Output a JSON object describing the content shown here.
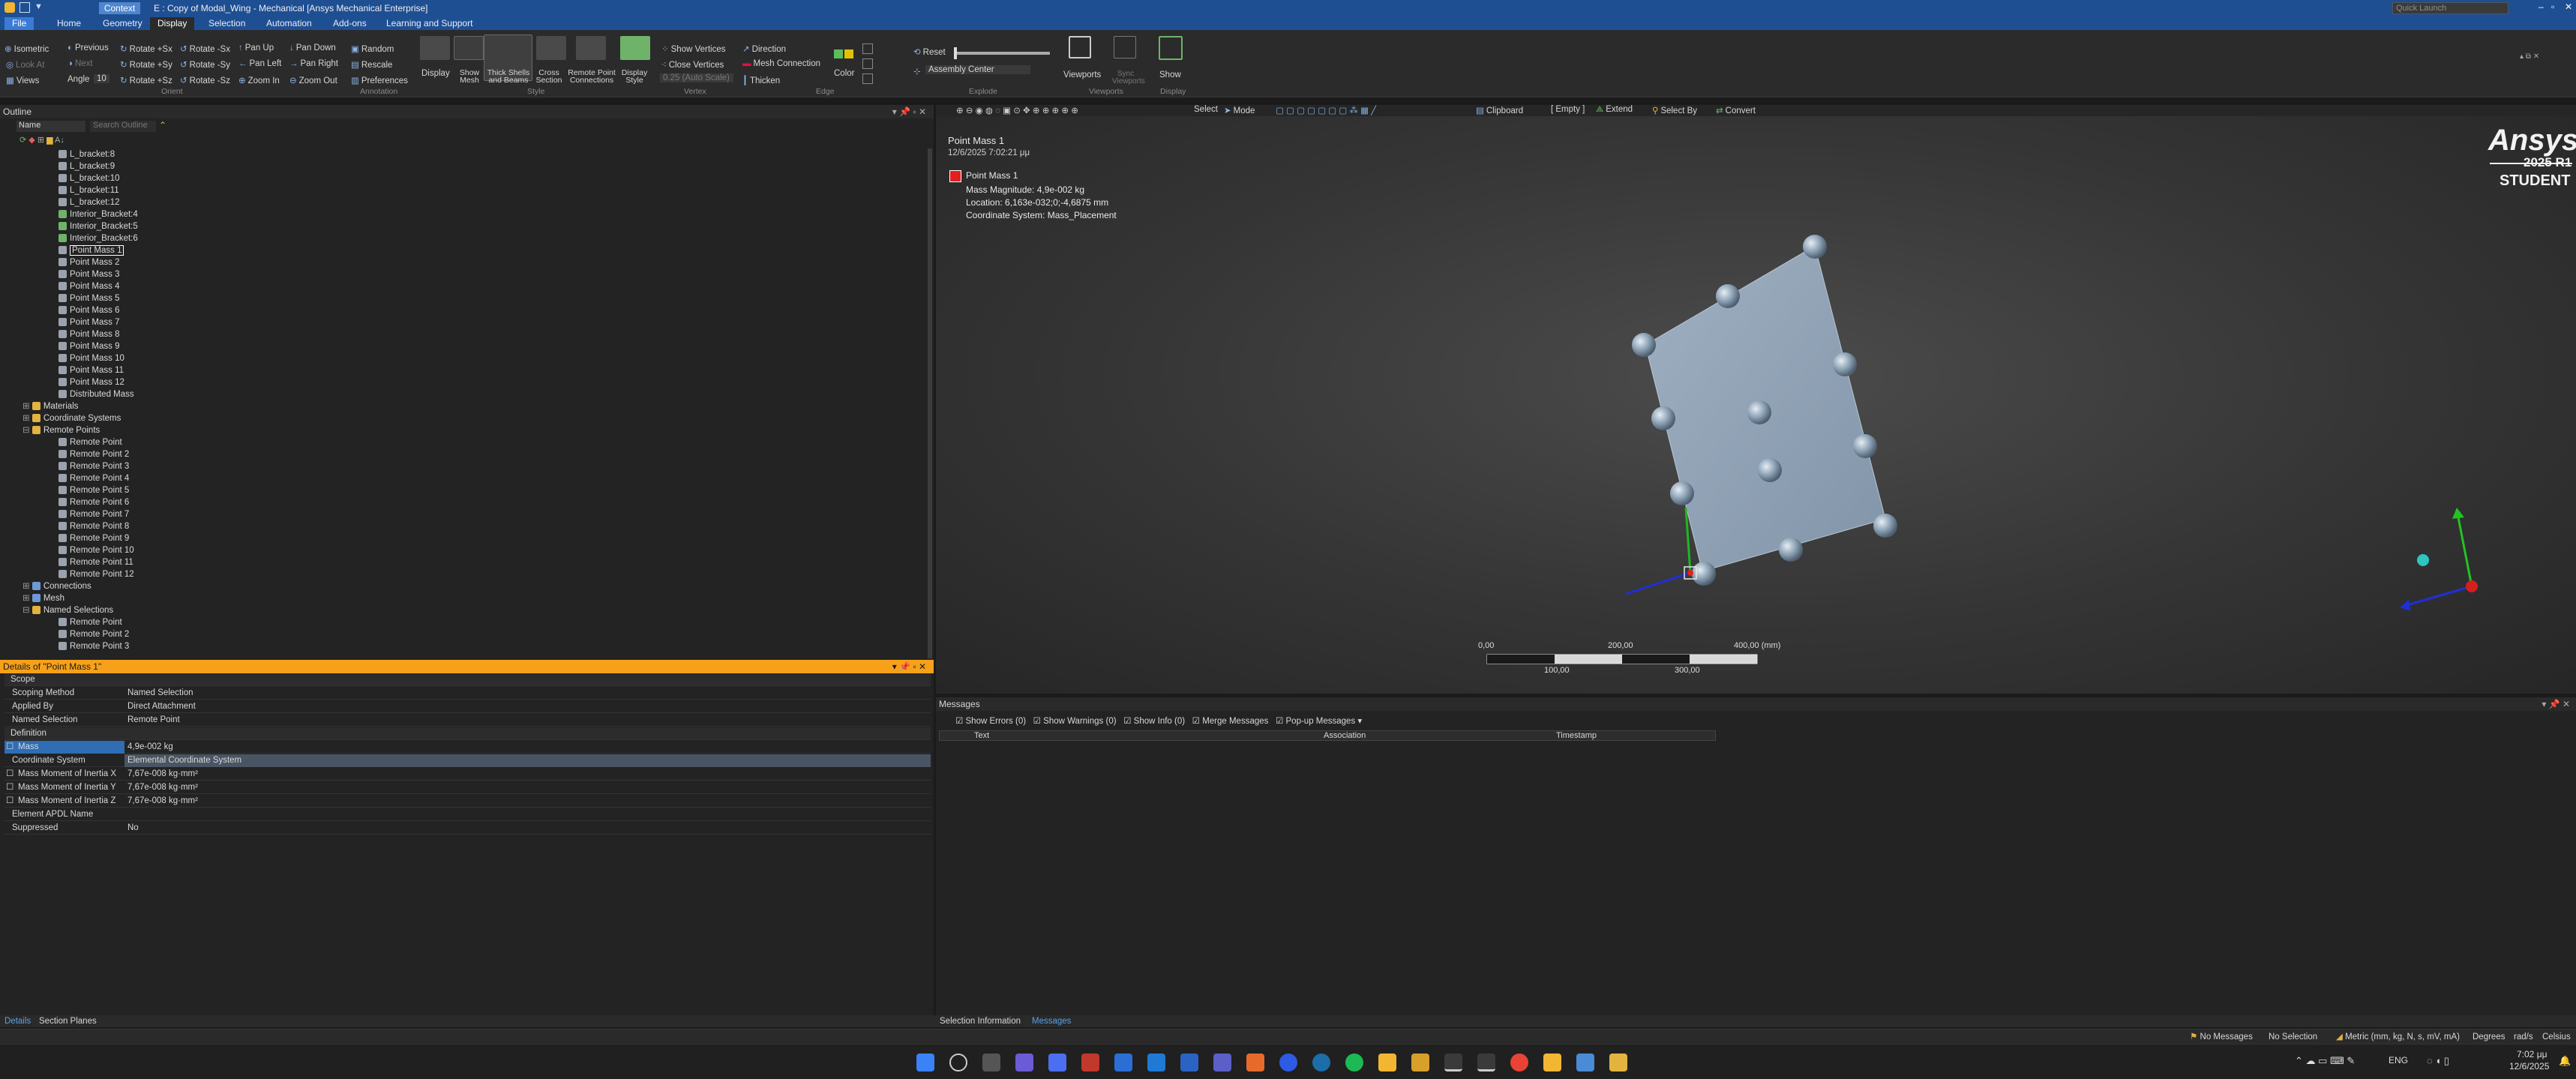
{
  "titlebar": {
    "context": "Context",
    "title": "E : Copy of Modal_Wing - Mechanical [Ansys Mechanical Enterprise]",
    "quick_launch": "Quick Launch"
  },
  "ribbon_tabs": [
    "File",
    "Home",
    "Geometry",
    "Display",
    "Selection",
    "Automation",
    "Add-ons",
    "Learning and Support"
  ],
  "ribbon": {
    "orient": [
      "Isometric",
      "Previous",
      "Next",
      "Look At",
      "Views",
      "Angle",
      "10",
      "Rotate +Sx",
      "Rotate -Sx",
      "Rotate +Sy",
      "Rotate -Sy",
      "Rotate +Sz",
      "Rotate -Sz",
      "Pan Up",
      "Pan Down",
      "Pan Left",
      "Pan Right",
      "Zoom In",
      "Zoom Out"
    ],
    "annotation": [
      "Random",
      "Rescale",
      "Preferences"
    ],
    "style": [
      "Display",
      "Show Mesh",
      "Thick Shells and Beams",
      "Cross Section",
      "Remote Point Connections",
      "Display Style"
    ],
    "vertex": [
      "Show Vertices",
      "Close Vertices",
      "0.25 (Auto Scale)"
    ],
    "edge": [
      "Direction",
      "Mesh Connection",
      "Thicken",
      "Color"
    ],
    "explode": [
      "Reset",
      "Assembly Center"
    ],
    "viewports": [
      "Viewports",
      "Sync Viewports"
    ],
    "display": [
      "Show"
    ],
    "groups": [
      "Orient",
      "Annotation",
      "Style",
      "Vertex",
      "Edge",
      "Explode",
      "Viewports",
      "Display"
    ]
  },
  "outline": {
    "title": "Outline",
    "name_label": "Name",
    "search_placeholder": "Search Outline",
    "items": [
      "L_bracket:8",
      "L_bracket:9",
      "L_bracket:10",
      "L_bracket:11",
      "L_bracket:12",
      "Interior_Bracket:4",
      "Interior_Bracket:5",
      "Interior_Bracket:6",
      "Point Mass 1",
      "Point Mass 2",
      "Point Mass 3",
      "Point Mass 4",
      "Point Mass 5",
      "Point Mass 6",
      "Point Mass 7",
      "Point Mass 8",
      "Point Mass 9",
      "Point Mass 10",
      "Point Mass 11",
      "Point Mass 12",
      "Distributed Mass",
      "Materials",
      "Coordinate Systems",
      "Remote Points",
      "Remote Point",
      "Remote Point 2",
      "Remote Point 3",
      "Remote Point 4",
      "Remote Point 5",
      "Remote Point 6",
      "Remote Point 7",
      "Remote Point 8",
      "Remote Point 9",
      "Remote Point 10",
      "Remote Point 11",
      "Remote Point 12",
      "Connections",
      "Mesh",
      "Named Selections",
      "Remote Point",
      "Remote Point 2",
      "Remote Point 3"
    ]
  },
  "details": {
    "title": "Details of \"Point Mass 1\"",
    "rows": [
      {
        "k": "Scope",
        "v": "",
        "sec": true
      },
      {
        "k": "Scoping Method",
        "v": "Named Selection"
      },
      {
        "k": "Applied By",
        "v": "Direct Attachment"
      },
      {
        "k": "Named Selection",
        "v": "Remote Point"
      },
      {
        "k": "Definition",
        "v": "",
        "sec": true
      },
      {
        "k": "Mass",
        "v": "4,9e-002 kg"
      },
      {
        "k": "Coordinate System",
        "v": "Elemental Coordinate System"
      },
      {
        "k": "Mass Moment of Inertia X",
        "v": "7,67e-008 kg·mm²"
      },
      {
        "k": "Mass Moment of Inertia Y",
        "v": "7,67e-008 kg·mm²"
      },
      {
        "k": "Mass Moment of Inertia Z",
        "v": "7,67e-008 kg·mm²"
      },
      {
        "k": "Element APDL Name",
        "v": ""
      },
      {
        "k": "Suppressed",
        "v": "No"
      }
    ]
  },
  "viewport": {
    "toolbar": [
      "Select",
      "Mode",
      "Clipboard",
      "[ Empty ]",
      "Extend",
      "Select By",
      "Convert"
    ],
    "title": "Point Mass 1",
    "date": "12/6/2025 7:02:21 μμ",
    "legend_label": "Point Mass 1",
    "info": [
      "Mass Magnitude: 4,9e-002 kg",
      "Location: 6,163e-032;0;-4,6875 mm",
      "Coordinate System: Mass_Placement"
    ],
    "brand": "Ansys",
    "version": "2025 R1",
    "edition": "STUDENT",
    "scale": {
      "t0": "0,00",
      "t200": "200,00",
      "t400": "400,00 (mm)",
      "t100": "100,00",
      "t300": "300,00"
    }
  },
  "messages": {
    "title": "Messages",
    "filters": [
      {
        "label": "Show Errors",
        "count": "(0)"
      },
      {
        "label": "Show Warnings",
        "count": "(0)"
      },
      {
        "label": "Show Info",
        "count": "(0)"
      },
      {
        "label": "Merge Messages",
        "count": ""
      },
      {
        "label": "Pop-up Messages",
        "count": ""
      }
    ],
    "columns": [
      "Text",
      "Association",
      "Timestamp"
    ]
  },
  "bottom_tabs": {
    "left": [
      "Details",
      "Section Planes"
    ],
    "right": [
      "Selection Information",
      "Messages"
    ]
  },
  "status": {
    "messages": "No Messages",
    "selection": "No Selection",
    "units": "Metric (mm, kg, N, s, mV, mA)",
    "angle": "Degrees",
    "rate": "rad/s",
    "temp": "Celsius"
  },
  "taskbar": {
    "lang": "ENG",
    "time": "7:02 μμ",
    "date": "12/6/2025"
  }
}
